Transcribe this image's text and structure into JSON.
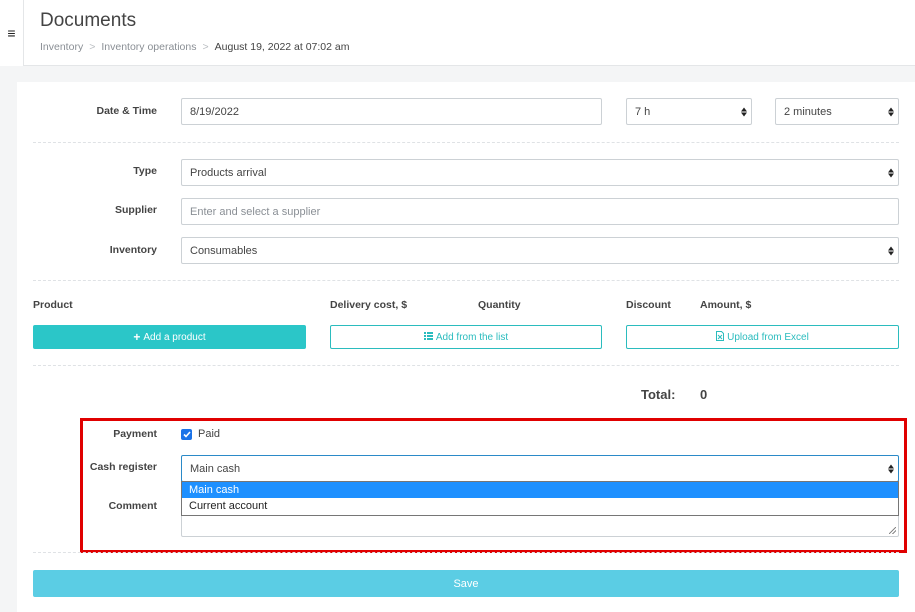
{
  "header": {
    "menu_icon": "hamburger-icon",
    "title": "Documents",
    "breadcrumb": [
      "Inventory",
      "Inventory operations",
      "August 19, 2022 at 07:02 am"
    ],
    "separator": ">"
  },
  "form": {
    "datetime": {
      "label": "Date & Time",
      "date": "8/19/2022",
      "hours": "7 h",
      "minutes": "2 minutes"
    },
    "type": {
      "label": "Type",
      "value": "Products arrival"
    },
    "supplier": {
      "label": "Supplier",
      "placeholder": "Enter and select a supplier"
    },
    "inventory": {
      "label": "Inventory",
      "value": "Consumables"
    }
  },
  "products": {
    "columns": [
      "Product",
      "Delivery cost, $",
      "Quantity",
      "Discount",
      "Amount, $"
    ],
    "add_product": "Add a product",
    "add_from_list": "Add from the list",
    "upload_excel": "Upload from Excel"
  },
  "total": {
    "label": "Total:",
    "value": "0"
  },
  "payment": {
    "label": "Payment",
    "paid_label": "Paid",
    "paid_checked": true,
    "cash_register_label": "Cash register",
    "cash_register_value": "Main cash",
    "options": [
      "Main cash",
      "Current account"
    ],
    "comment_label": "Comment"
  },
  "save_label": "Save",
  "colors": {
    "accent": "#2bc6c8",
    "save": "#5bcde4",
    "highlight": "#e00000",
    "option_selected": "#1e90ff"
  }
}
